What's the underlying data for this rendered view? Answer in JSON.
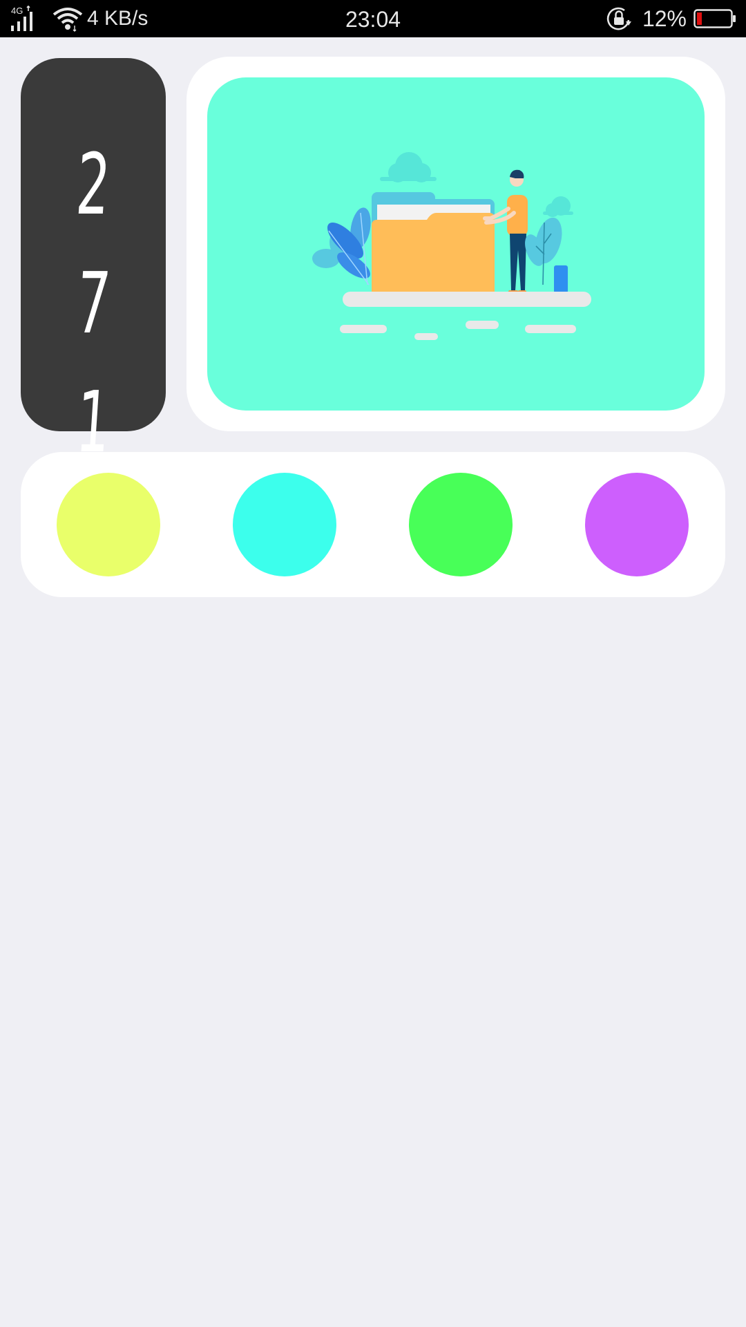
{
  "status_bar": {
    "network_type": "4G",
    "network_speed": "4 KB/s",
    "time": "23:04",
    "battery_percent": "12%",
    "icons": [
      "signal-icon",
      "wifi-icon",
      "rotation-lock-icon",
      "battery-icon"
    ],
    "battery_low_color": "#e01010"
  },
  "counter": {
    "digits": [
      "2",
      "7",
      "1"
    ],
    "background_color": "#3a3a3a"
  },
  "illustration": {
    "icon": "folder-person-illustration",
    "background_color": "#69ffdb"
  },
  "color_swatches": [
    {
      "name": "yellow",
      "color": "#e9ff6a"
    },
    {
      "name": "cyan",
      "color": "#3cffec"
    },
    {
      "name": "green",
      "color": "#48ff58"
    },
    {
      "name": "purple",
      "color": "#cd5ffd"
    }
  ]
}
